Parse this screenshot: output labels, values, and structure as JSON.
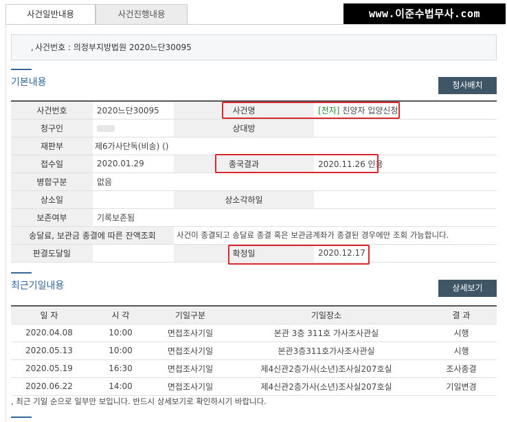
{
  "tabs": [
    {
      "label": "사건일반내용",
      "active": true
    },
    {
      "label": "사건진행내용",
      "active": false
    }
  ],
  "watermark": "www.이준수법무사.com",
  "case_summary": {
    "prefix": ",",
    "text": "사건번호 : 의정부지방법원 2020느단30095"
  },
  "basic": {
    "title": "기본내용",
    "button": "청사배치",
    "rows": {
      "case_no": {
        "label": "사건번호",
        "value": "2020느단30095"
      },
      "case_name": {
        "label": "사건명",
        "tag": "[전자]",
        "value": " 친양자 입양신청"
      },
      "claimant": {
        "label": "청구인"
      },
      "opponent": {
        "label": "상대방",
        "value": ""
      },
      "division": {
        "label": "재판부",
        "value": "제6가사단독(비송) ()"
      },
      "received": {
        "label": "접수일",
        "value": "2020.01.29"
      },
      "final_result": {
        "label": "종국결과",
        "value": "2020.11.26 인용"
      },
      "merged": {
        "label": "병합구분",
        "value": "없음"
      },
      "appeal_date": {
        "label": "상소일",
        "value": ""
      },
      "appeal_dismiss": {
        "label": "상소각하일",
        "value": ""
      },
      "preserve": {
        "label": "보존여부",
        "value": "기록보존됨"
      },
      "balance": {
        "label": "송달료, 보관금 종결에 따른 잔액조회",
        "value": "사건이 종결되고 송달료 종결 혹은 보관금계좌가 종결된 경우에만 조회 가능합니다."
      },
      "judgment_served": {
        "label": "판결도달일",
        "value": ""
      },
      "confirmed": {
        "label": "확정일",
        "value": "2020.12.17"
      }
    }
  },
  "history": {
    "title": "최근기일내용",
    "button": "상세보기",
    "columns": [
      "일 자",
      "시 각",
      "기일구분",
      "기일장소",
      "결 과"
    ],
    "rows": [
      [
        "2020.04.08",
        "10:00",
        "면접조사기일",
        "본관 3층 311호 가사조사관실",
        "시행"
      ],
      [
        "2020.05.13",
        "10:00",
        "면접조사기일",
        "본관3층311호가사조사관실",
        "시행"
      ],
      [
        "2020.05.19",
        "16:30",
        "면접조사기일",
        "제4신관2층가사(소년)조사실207호실",
        "조사종결"
      ],
      [
        "2020.06.22",
        "14:00",
        "면접조사기일",
        "제4신관2층가사(소년)조사실207호실",
        "기일변경"
      ]
    ],
    "notice": ", 최근 기일 순으로 일부만 보입니다. 반드시 상세보기로 확인하시기 바랍니다."
  }
}
